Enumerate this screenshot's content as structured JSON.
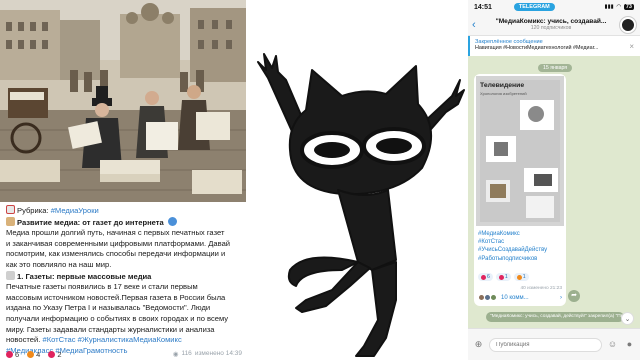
{
  "post": {
    "rubric_prefix": "Рубрика: ",
    "rubric_tag": "#МедиаУроки",
    "title": "Развитие медиа: от газет до интернета",
    "paragraph1": [
      "Медиа прошли долгий путь, начиная с первых печатных газет",
      "и заканчивая современными цифровыми платформами. Давай",
      "посмотрим, как изменялись способы передачи информации и",
      "как это повлияло на наш мир."
    ],
    "section_heading": "1. Газеты: первые массовые медиа",
    "paragraph2": [
      "Печатные газеты появились в 17 веке и стали первым",
      "массовым источником новостей.Первая газета в России была",
      "издана по Указу Петра I и называлась \"Ведомости\". Люди",
      "получали информацию о событиях в своих городах и по всему",
      "миру. Газеты задавали стандарты журналистики и анализа"
    ],
    "line_tail_text": "новостей.",
    "line_tail_tags": "#КотСтас #ЖурналистикаМедиаКомикс",
    "last_tags": "#Медиакласс #МедиаГрамотность",
    "reactions": [
      {
        "icon": "heart-icon",
        "color": "#e0245e",
        "count": "6"
      },
      {
        "icon": "fire-icon",
        "color": "#f08a1c",
        "count": "4"
      },
      {
        "icon": "heart-icon",
        "color": "#e0245e",
        "count": "2"
      }
    ],
    "views": "116",
    "edited_time": "изменено 14:39"
  },
  "phone": {
    "time": "14:51",
    "status_pill": "TELEGRAM",
    "battery": "73",
    "chat_title": "\"МедиаКомикс: учись, создавай...",
    "subscribers": "120 подписчиков",
    "pinned_label": "Закреплённое сообщение",
    "pinned_text": "Навигация #НовостиМедиатехнологий #Медиаг...",
    "date": "15 января",
    "post_image_title": "Телевидение",
    "post_image_subtitle": "Хронология изобретений",
    "tags": [
      "#МедиаКомикс",
      "#КотСтас",
      "#УчисьСоздавайДейству",
      "#Работыподписчиков"
    ],
    "reactions": [
      {
        "color": "#e0245e",
        "count": "6"
      },
      {
        "color": "#e0245e",
        "count": "1"
      },
      {
        "color": "#f08a1c",
        "count": "1"
      }
    ],
    "views_time": "40 изменено 21:23",
    "comments": "10 комм...",
    "bottom_pill": "\"МедиаКомикс: учись, создавай, действуй!\" закрепил(а) \"Привет! Добро...\"",
    "composer_placeholder": "Публикация"
  },
  "colors": {
    "link": "#2e7cc7",
    "phone_bg": "#dfe8cf",
    "telegram_blue": "#2aa3e0"
  }
}
